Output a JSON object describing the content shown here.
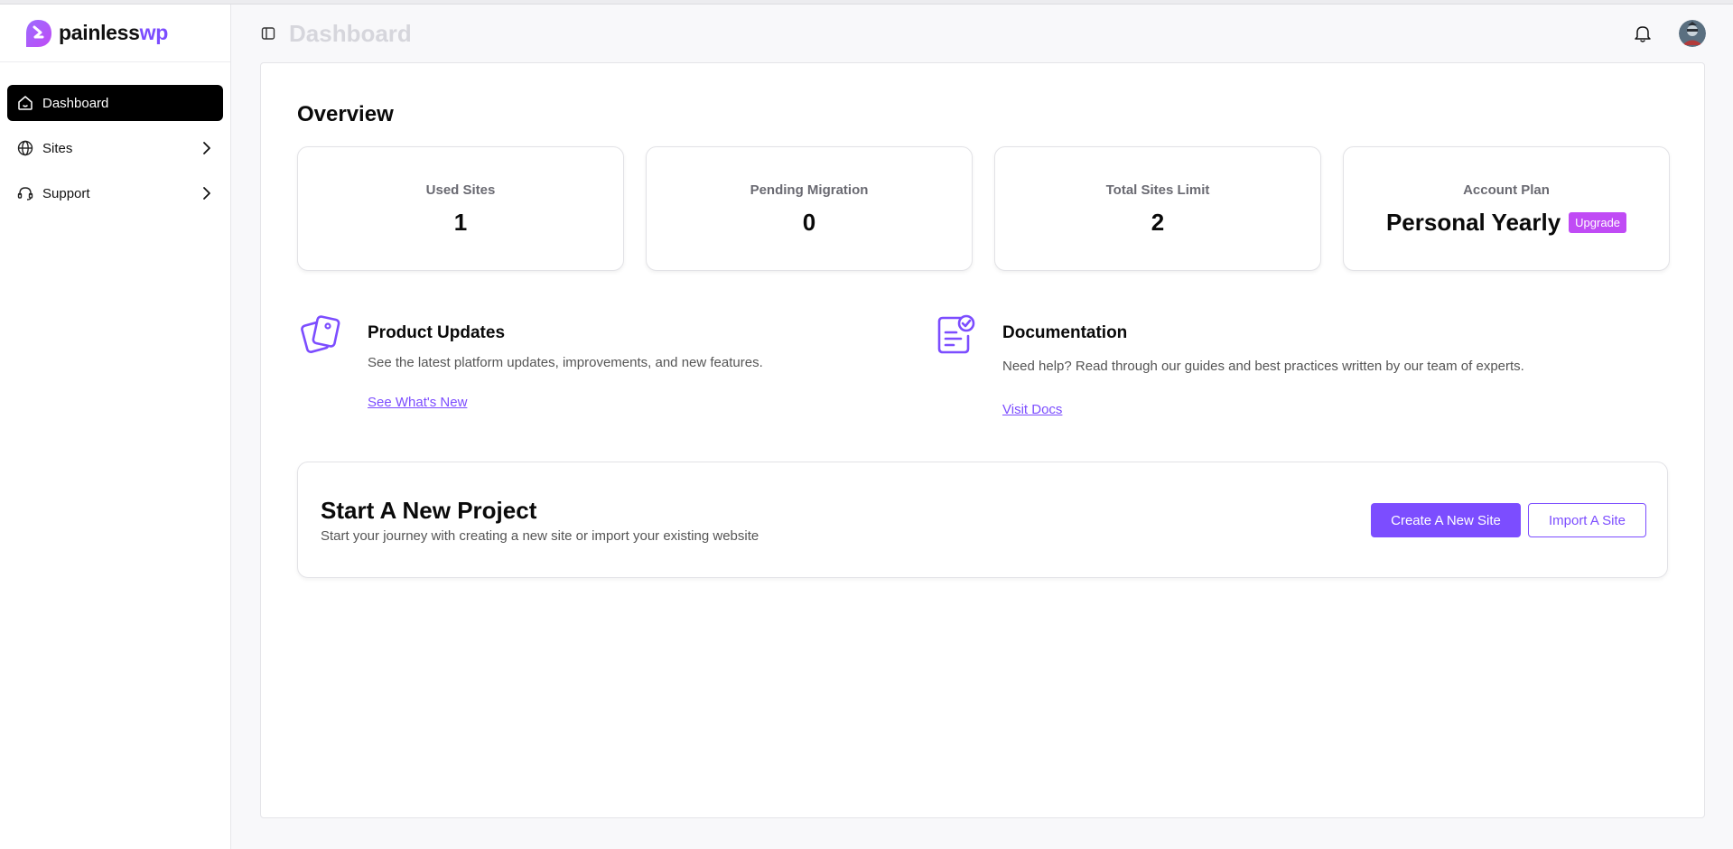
{
  "brand": {
    "name_main": "painless",
    "name_accent": "wp"
  },
  "sidebar": {
    "items": [
      {
        "label": "Dashboard",
        "icon": "home-icon",
        "active": true
      },
      {
        "label": "Sites",
        "icon": "globe-icon",
        "active": false
      },
      {
        "label": "Support",
        "icon": "headset-icon",
        "active": false
      }
    ]
  },
  "header": {
    "title": "Dashboard"
  },
  "overview": {
    "title": "Overview",
    "stats": [
      {
        "label": "Used Sites",
        "value": "1"
      },
      {
        "label": "Pending Migration",
        "value": "0"
      },
      {
        "label": "Total Sites Limit",
        "value": "2"
      },
      {
        "label": "Account Plan",
        "value": "Personal Yearly",
        "badge": "Upgrade"
      }
    ]
  },
  "features": {
    "updates": {
      "title": "Product Updates",
      "description": "See the latest platform updates, improvements, and new features.",
      "link": "See What's New"
    },
    "docs": {
      "title": "Documentation",
      "description": "Need help? Read through our guides and best practices written by our team of experts.",
      "link": "Visit Docs"
    }
  },
  "project": {
    "title": "Start A New Project",
    "description": "Start your journey with creating a new site or import your existing website",
    "primary_button": "Create A New Site",
    "secondary_button": "Import A Site"
  },
  "colors": {
    "accent": "#7c4dff",
    "badge": "#c04bf5",
    "active_nav": "#000000"
  }
}
